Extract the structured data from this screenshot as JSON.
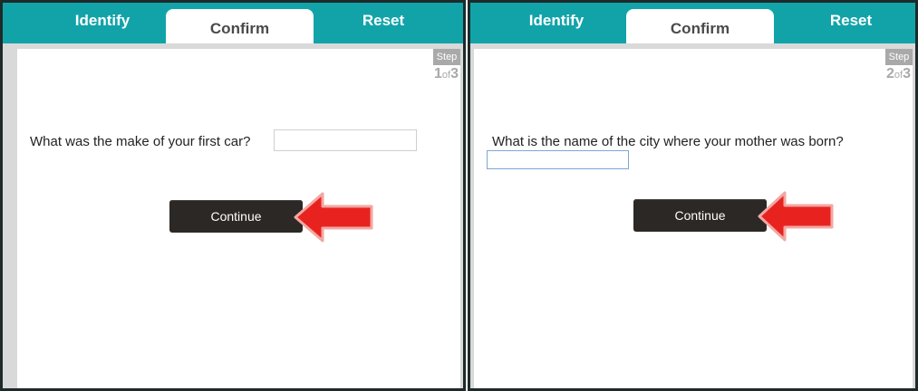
{
  "tabs": {
    "identify": "Identify",
    "confirm": "Confirm",
    "reset": "Reset"
  },
  "step": {
    "badge": "Step",
    "of": "of"
  },
  "left": {
    "current_step": "1",
    "total_steps": "3",
    "question": "What was the make of your first car?",
    "answer_value": "",
    "continue_label": "Continue"
  },
  "right": {
    "current_step": "2",
    "total_steps": "3",
    "question": "What is the name of the city where your mother was born?",
    "answer_value": "",
    "continue_label": "Continue"
  },
  "colors": {
    "teal": "#12a3a9",
    "button": "#2c2826",
    "arrow": "#e8231f"
  },
  "icons": {
    "annotation": "red-arrow-left-icon"
  }
}
